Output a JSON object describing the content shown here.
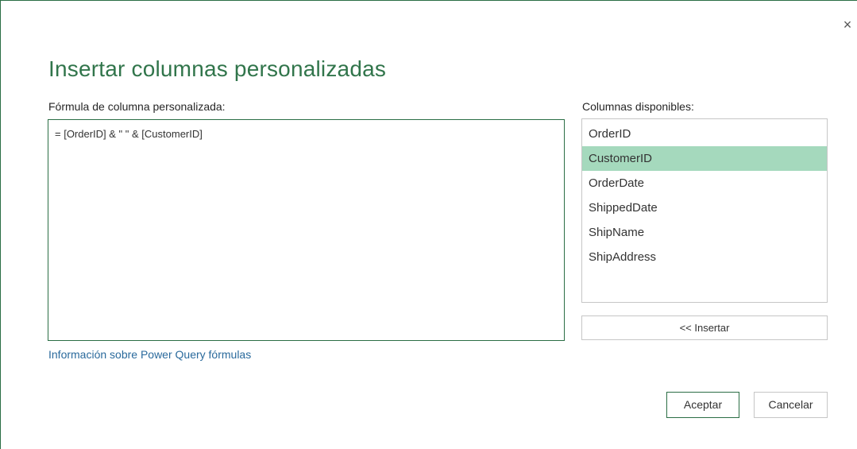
{
  "dialog": {
    "title": "Insertar columnas personalizadas",
    "close_glyph": "×"
  },
  "formula": {
    "label": "Fórmula de columna personalizada:",
    "value": "= [OrderID] & \" \" & [CustomerID]"
  },
  "info_link": "Información sobre Power Query fórmulas",
  "columns": {
    "label": "Columnas disponibles:",
    "items": [
      {
        "label": "OrderID",
        "selected": false
      },
      {
        "label": "CustomerID",
        "selected": true
      },
      {
        "label": "OrderDate",
        "selected": false
      },
      {
        "label": "ShippedDate",
        "selected": false
      },
      {
        "label": "ShipName",
        "selected": false
      },
      {
        "label": "ShipAddress",
        "selected": false
      }
    ],
    "insert_label": "<< Insertar"
  },
  "buttons": {
    "ok_label": "Aceptar",
    "cancel_label": "Cancelar"
  },
  "colors": {
    "accent": "#31754b",
    "selected_row": "#a5d9bd",
    "link": "#2a6a9c"
  }
}
